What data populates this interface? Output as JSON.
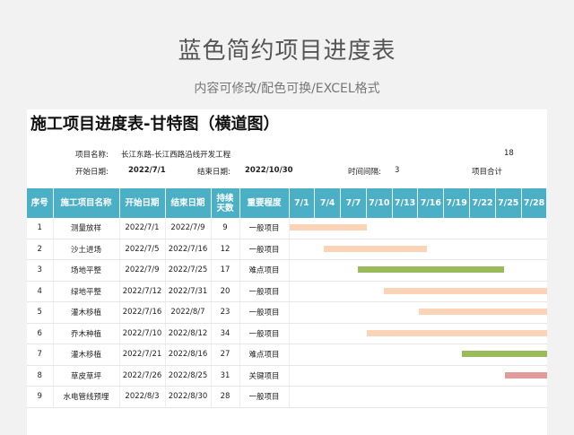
{
  "header": {
    "title": "蓝色简约项目进度表",
    "subtitle": "内容可修改/配色可换/EXCEL格式"
  },
  "sheet": {
    "title": "施工项目进度表-甘特图（横道图）",
    "project_name_label": "项目名称:",
    "project_name": "长江东路-长江西路沿线开发工程",
    "top_right_number": "18",
    "start_label": "开始日期:",
    "start_value": "2022/7/1",
    "end_label": "结束日期:",
    "end_value": "2022/10/30",
    "interval_label": "时间间隔:",
    "interval_value": "3",
    "total_label": "项目合计"
  },
  "columns": [
    "序号",
    "施工项目名称",
    "开始日期",
    "结束日期",
    "持续\n天数",
    "重要程度"
  ],
  "dates": [
    "7/1",
    "7/4",
    "7/7",
    "7/10",
    "7/13",
    "7/16",
    "7/19",
    "7/22",
    "7/25",
    "7/28"
  ],
  "tasks": [
    {
      "no": "1",
      "name": "测量放样",
      "start": "2022/7/1",
      "end": "2022/7/9",
      "days": "9",
      "level": "一般项目",
      "bar_start_day": 1,
      "bar_days": 9,
      "color": "#fbd3b6"
    },
    {
      "no": "2",
      "name": "沙土进场",
      "start": "2022/7/5",
      "end": "2022/7/16",
      "days": "12",
      "level": "一般项目",
      "bar_start_day": 5,
      "bar_days": 12,
      "color": "#fbd3b6"
    },
    {
      "no": "3",
      "name": "场地平整",
      "start": "2022/7/9",
      "end": "2022/7/25",
      "days": "17",
      "level": "难点项目",
      "bar_start_day": 9,
      "bar_days": 17,
      "color": "#9abb59"
    },
    {
      "no": "4",
      "name": "绿地平整",
      "start": "2022/7/12",
      "end": "2022/7/31",
      "days": "20",
      "level": "一般项目",
      "bar_start_day": 12,
      "bar_days": 20,
      "color": "#fbd3b6"
    },
    {
      "no": "5",
      "name": "灌木移植",
      "start": "2022/7/16",
      "end": "2022/8/7",
      "days": "23",
      "level": "一般项目",
      "bar_start_day": 16,
      "bar_days": 23,
      "color": "#fbd3b6"
    },
    {
      "no": "6",
      "name": "乔木种植",
      "start": "2022/7/10",
      "end": "2022/8/12",
      "days": "34",
      "level": "一般项目",
      "bar_start_day": 10,
      "bar_days": 34,
      "color": "#fbd3b6"
    },
    {
      "no": "7",
      "name": "灌木移植",
      "start": "2022/7/21",
      "end": "2022/8/16",
      "days": "27",
      "level": "难点项目",
      "bar_start_day": 21,
      "bar_days": 27,
      "color": "#9abb59"
    },
    {
      "no": "8",
      "name": "草皮草坪",
      "start": "2022/7/26",
      "end": "2022/8/25",
      "days": "31",
      "level": "关键项目",
      "bar_start_day": 26,
      "bar_days": 31,
      "color": "#e39a9a"
    },
    {
      "no": "9",
      "name": "水电管线预埋",
      "start": "2022/8/3",
      "end": "2022/8/30",
      "days": "28",
      "level": "一般项目",
      "bar_start_day": 34,
      "bar_days": 28,
      "color": "#fbd3b6"
    }
  ]
}
